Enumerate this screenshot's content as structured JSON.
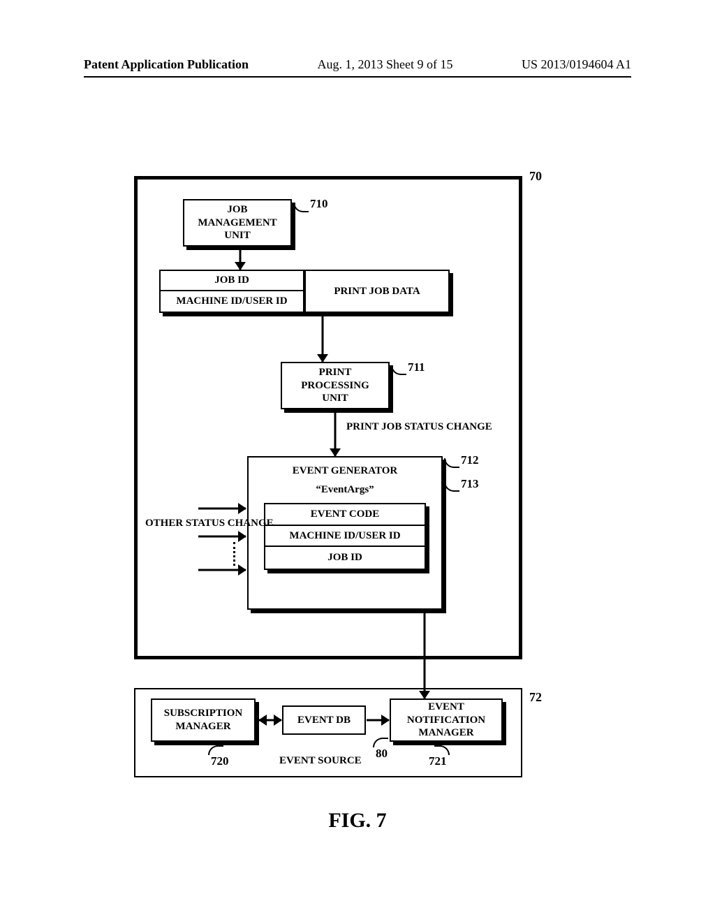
{
  "header": {
    "left": "Patent Application Publication",
    "center": "Aug. 1, 2013   Sheet 9 of 15",
    "right": "US 2013/0194604 A1"
  },
  "refs": {
    "r70": "70",
    "r710": "710",
    "r711": "711",
    "r712": "712",
    "r713": "713",
    "r72": "72",
    "r720": "720",
    "r721": "721",
    "r80": "80"
  },
  "boxes": {
    "job_mgmt": "JOB\nMANAGEMENT\nUNIT",
    "jobid": "JOB ID",
    "machine_user": "MACHINE ID/USER ID",
    "print_job_data": "PRINT JOB DATA",
    "print_proc": "PRINT\nPROCESSING\nUNIT",
    "evgen_title": "EVENT GENERATOR",
    "eventargs": "“EventArgs”",
    "ev_code": "EVENT CODE",
    "ev_mu": "MACHINE ID/USER ID",
    "ev_jobid": "JOB ID",
    "sub_mgr": "SUBSCRIPTION\nMANAGER",
    "event_db": "EVENT DB",
    "ev_notif": "EVENT\nNOTIFICATION\nMANAGER",
    "event_source": "EVENT SOURCE"
  },
  "labels": {
    "status_change": "PRINT JOB\nSTATUS CHANGE",
    "other_status": "OTHER\nSTATUS\nCHANGE"
  },
  "figure": "FIG. 7"
}
